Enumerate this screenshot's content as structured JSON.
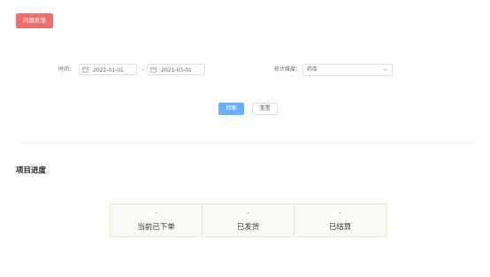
{
  "toolbar": {
    "feedback_label": "问题反馈"
  },
  "filters": {
    "time_label": "时间：",
    "start_date": "2021-01-01",
    "separator": "-",
    "end_date": "2021-03-01",
    "dimension_label": "统计维度：",
    "dimension_value": "药库"
  },
  "actions": {
    "search_label": "检索",
    "reset_label": "重置"
  },
  "section": {
    "title": "项目进度"
  },
  "stats": [
    {
      "value": "-",
      "label": "当前已下单"
    },
    {
      "value": "-",
      "label": "已发货"
    },
    {
      "value": "-",
      "label": "已结算"
    }
  ],
  "colors": {
    "feedback": "#ee6e6e",
    "primary": "#66b1ff"
  }
}
